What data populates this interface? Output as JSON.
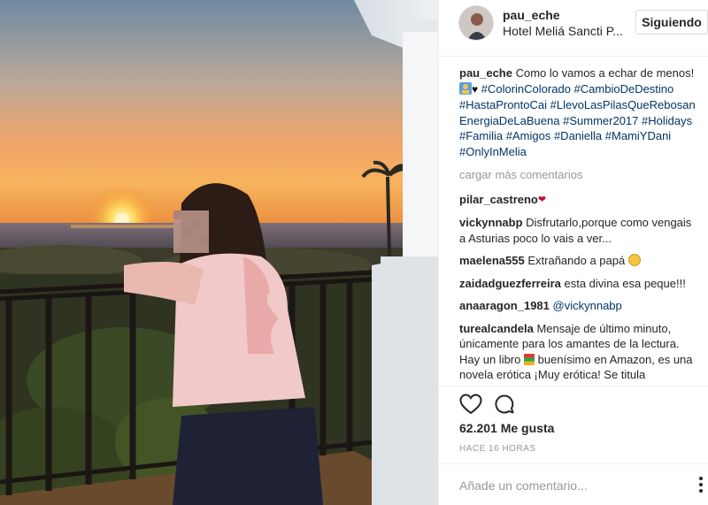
{
  "post": {
    "username": "pau_eche",
    "location": "Hotel Meliá Sancti P...",
    "follow_label": "Siguiendo",
    "caption": {
      "username": "pau_eche",
      "text_start": "Como lo vamos a echar de menos!",
      "hashtags": [
        "#ColorinColorado",
        "#CambioDeDestino",
        "#HastaProntoCai",
        "#LlevoLasPilasQueRebosanEnergiaDeLaBuena",
        "#Summer2017",
        "#Holidays",
        "#Familia",
        "#Amigos",
        "#Daniella",
        "#MamiYDani",
        "#OnlyInMelia"
      ]
    },
    "load_more": "cargar más comentarios",
    "comments": [
      {
        "user": "pilar_castreno",
        "text": ""
      },
      {
        "user": "vickynnabp",
        "text": "Disfrutarlo,porque como vengais a Asturias poco lo vais a ver..."
      },
      {
        "user": "maelena555",
        "text": "Extrañando a papá"
      },
      {
        "user": "zaidadguezferreira",
        "text": "esta divina esa peque!!!"
      },
      {
        "user": "anaaragon_1981",
        "mention": "@vickynnabp"
      },
      {
        "user": "turealcandela",
        "text_a": "Mensaje de último minuto, únicamente para los amantes de la lectura. Hay un libro",
        "text_b": "buenísimo en Amazon, es una novela erótica ¡Muy erótica! Se titula"
      }
    ],
    "likes": "62.201 Me gusta",
    "timestamp": "HACE 16 HORAS",
    "comment_placeholder": "Añade un comentario...",
    "icons": [
      "heart-icon",
      "comment-icon",
      "more-options-icon"
    ],
    "colors": {
      "hashtag": "#003569",
      "secondary_text": "#999999",
      "border": "#efefef"
    }
  }
}
